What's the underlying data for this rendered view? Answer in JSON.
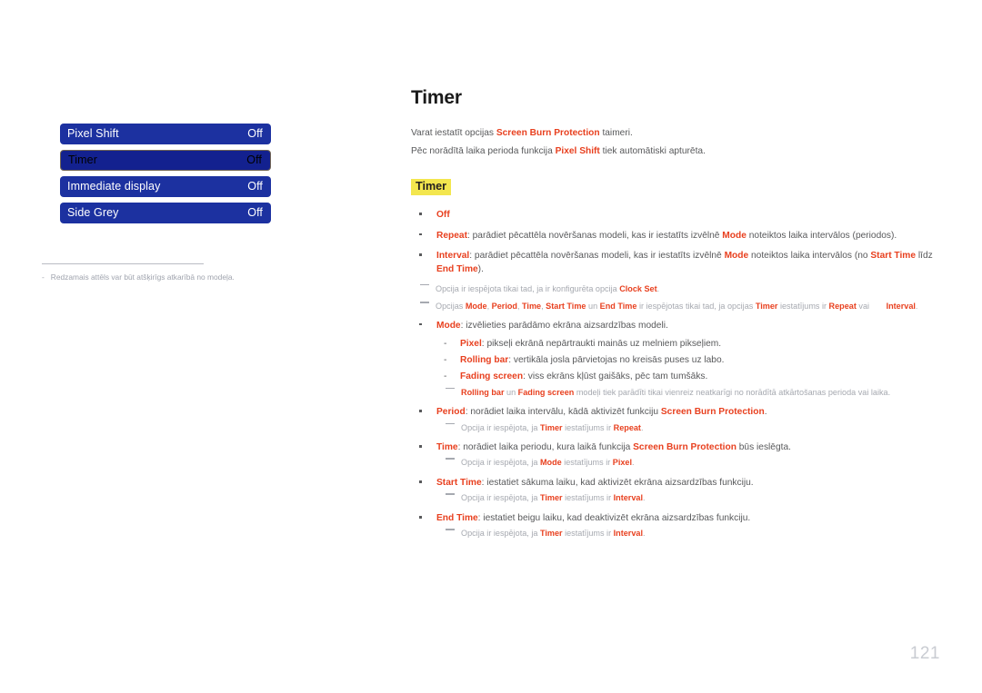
{
  "page": {
    "number": "121",
    "title": "Timer"
  },
  "osd": {
    "rows": [
      {
        "label": "Pixel Shift",
        "value": "Off",
        "selected": false
      },
      {
        "label": "Timer",
        "value": "Off",
        "selected": true
      },
      {
        "label": "Immediate display",
        "value": "Off",
        "selected": false
      },
      {
        "label": "Side Grey",
        "value": "Off",
        "selected": false
      }
    ],
    "footnote_dash": "-",
    "footnote": "Redzamais attēls var būt atšķirīgs atkarībā no modeļa."
  },
  "intro": {
    "line1_pre": "Varat iestatīt opcijas ",
    "line1_acc": "Screen Burn Protection",
    "line1_post": " taimeri.",
    "line2_pre": "Pēc norādītā laika perioda funkcija ",
    "line2_acc": "Pixel Shift",
    "line2_post": " tiek automātiski apturēta."
  },
  "section": {
    "chip": "Timer"
  },
  "bullets": {
    "off": {
      "term": "Off"
    },
    "repeat": {
      "term": "Repeat",
      "text_a": ": parādiet pēcattēla novēršanas modeli, kas ir iestatīts izvēlnē ",
      "acc_mode": "Mode",
      "text_b": " noteiktos laika intervālos (periodos)."
    },
    "interval": {
      "term": "Interval",
      "text_a": ": parādiet pēcattēla novēršanas modeli, kas ir iestatīts izvēlnē ",
      "acc_mode": "Mode",
      "text_b": " noteiktos laika intervālos (no ",
      "acc_start": "Start Time",
      "text_c": " līdz ",
      "acc_end": "End Time",
      "text_d": ")."
    },
    "note_clock": {
      "text_a": "Opcija ir iespējota tikai tad, ja ir konfigurēta opcija ",
      "acc": "Clock Set",
      "text_b": "."
    },
    "note_options": {
      "text_a": "Opcijas ",
      "acc1": "Mode",
      "sep1": ", ",
      "acc2": "Period",
      "sep2": ", ",
      "acc3": "Time",
      "sep3": ", ",
      "acc4": "Start Time",
      "text_b": " un ",
      "acc5": "End Time",
      "text_c": " ir iespējotas tikai tad, ja opcijas ",
      "acc6": "Timer",
      "text_d": " iestatījums ir ",
      "acc7": "Repeat",
      "text_e": " vai ",
      "acc8": "Interval",
      "text_f": "."
    },
    "mode": {
      "term": "Mode",
      "text": ": izvēlieties parādāmo ekrāna aizsardzības modeli.",
      "sub": [
        {
          "term": "Pixel",
          "text": ": pikseļi ekrānā nepārtraukti mainās uz melniem pikseļiem."
        },
        {
          "term": "Rolling bar",
          "text": ": vertikāla josla pārvietojas no kreisās puses uz labo."
        },
        {
          "term": "Fading screen",
          "text": ": viss ekrāns kļūst gaišāks, pēc tam tumšāks."
        }
      ],
      "note": {
        "acc1": "Rolling bar",
        "text_a": " un ",
        "acc2": "Fading screen",
        "text_b": " modeļi tiek parādīti tikai vienreiz neatkarīgi no norādītā atkārtošanas perioda vai laika."
      }
    },
    "period": {
      "term": "Period",
      "text_a": ": norādiet laika intervālu, kādā aktivizēt funkciju ",
      "acc": "Screen Burn Protection",
      "text_b": ".",
      "note": {
        "text_a": "Opcija ir iespējota, ja ",
        "acc1": "Timer",
        "text_b": " iestatījums ir ",
        "acc2": "Repeat",
        "text_c": "."
      }
    },
    "time": {
      "term": "Time",
      "text_a": ": norādiet laika periodu, kura laikā funkcija ",
      "acc": "Screen Burn Protection",
      "text_b": " būs ieslēgta.",
      "note": {
        "text_a": "Opcija ir iespējota, ja ",
        "acc1": "Mode",
        "text_b": " iestatījums ir ",
        "acc2": "Pixel",
        "text_c": "."
      }
    },
    "start_time": {
      "term": "Start Time",
      "text": ": iestatiet sākuma laiku, kad aktivizēt ekrāna aizsardzības funkciju.",
      "note": {
        "text_a": "Opcija ir iespējota, ja ",
        "acc1": "Timer",
        "text_b": " iestatījums ir ",
        "acc2": "Interval",
        "text_c": "."
      }
    },
    "end_time": {
      "term": "End Time",
      "text": ": iestatiet beigu laiku, kad deaktivizēt ekrāna aizsardzības funkciju.",
      "note": {
        "text_a": "Opcija ir iespējota, ja ",
        "acc1": "Timer",
        "text_b": " iestatījums ir ",
        "acc2": "Interval",
        "text_c": "."
      }
    }
  },
  "colors": {
    "accent": "#e8401f",
    "osd_blue": "#1c31a0",
    "osd_blue_selected": "#13218f",
    "highlight": "#f3e64e",
    "body_text": "#58595b",
    "note_text": "#a6a9b0"
  }
}
